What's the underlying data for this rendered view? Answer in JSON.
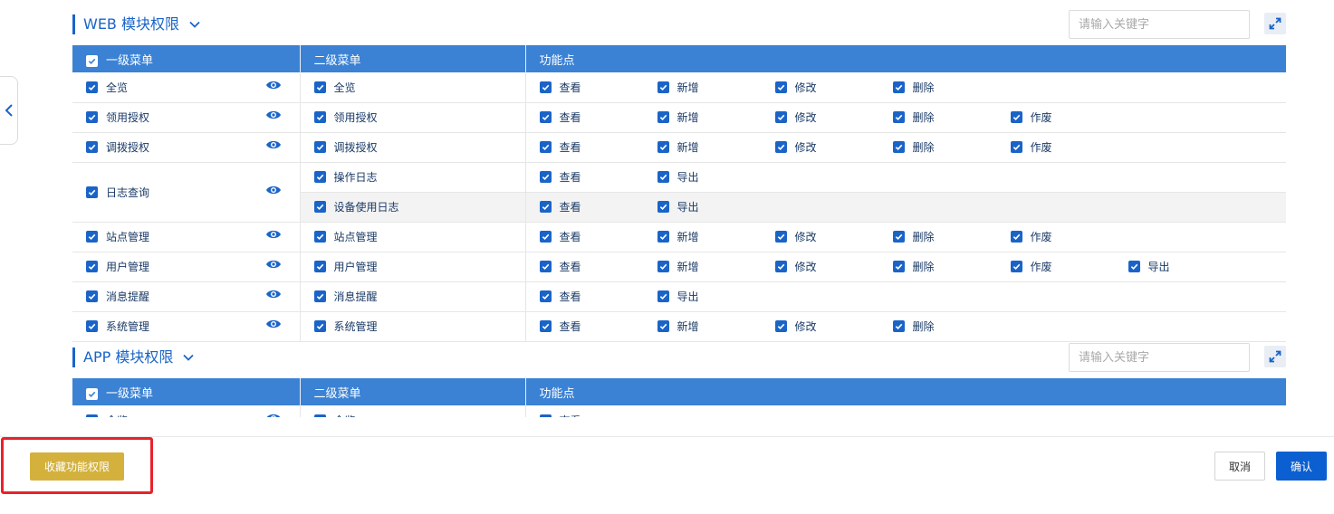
{
  "colors": {
    "accent": "#1a64c8",
    "header_bg": "#3b82d4",
    "favorite_button": "#d4b13c",
    "highlight_box": "#e8222b"
  },
  "sections": [
    {
      "title": "WEB 模块权限",
      "search_placeholder": "请输入关键字",
      "columns": [
        "一级菜单",
        "二级菜单",
        "功能点"
      ]
    },
    {
      "title": "APP 模块权限",
      "search_placeholder": "请输入关键字",
      "columns": [
        "一级菜单",
        "二级菜单",
        "功能点"
      ]
    }
  ],
  "web_rows": [
    {
      "menu1": "全览",
      "menu2": [
        {
          "name": "全览",
          "funcs": [
            "查看",
            "新增",
            "修改",
            "删除"
          ]
        }
      ]
    },
    {
      "menu1": "领用授权",
      "menu2": [
        {
          "name": "领用授权",
          "funcs": [
            "查看",
            "新增",
            "修改",
            "删除",
            "作废"
          ]
        }
      ]
    },
    {
      "menu1": "调拨授权",
      "menu2": [
        {
          "name": "调拨授权",
          "funcs": [
            "查看",
            "新增",
            "修改",
            "删除",
            "作废"
          ]
        }
      ]
    },
    {
      "menu1": "日志查询",
      "menu2": [
        {
          "name": "操作日志",
          "funcs": [
            "查看",
            "导出"
          ]
        },
        {
          "name": "设备使用日志",
          "funcs": [
            "查看",
            "导出"
          ]
        }
      ]
    },
    {
      "menu1": "站点管理",
      "menu2": [
        {
          "name": "站点管理",
          "funcs": [
            "查看",
            "新增",
            "修改",
            "删除",
            "作废"
          ]
        }
      ]
    },
    {
      "menu1": "用户管理",
      "menu2": [
        {
          "name": "用户管理",
          "funcs": [
            "查看",
            "新增",
            "修改",
            "删除",
            "作废",
            "导出"
          ]
        }
      ]
    },
    {
      "menu1": "消息提醒",
      "menu2": [
        {
          "name": "消息提醒",
          "funcs": [
            "查看",
            "导出"
          ]
        }
      ]
    },
    {
      "menu1": "系统管理",
      "menu2": [
        {
          "name": "系统管理",
          "funcs": [
            "查看",
            "新增",
            "修改",
            "删除"
          ]
        }
      ]
    }
  ],
  "app_rows": [
    {
      "menu1": "全览",
      "menu2": [
        {
          "name": "全览",
          "funcs": [
            "查看"
          ]
        }
      ]
    }
  ],
  "footer": {
    "favorite_label": "收藏功能权限",
    "cancel_label": "取消",
    "confirm_label": "确认"
  }
}
